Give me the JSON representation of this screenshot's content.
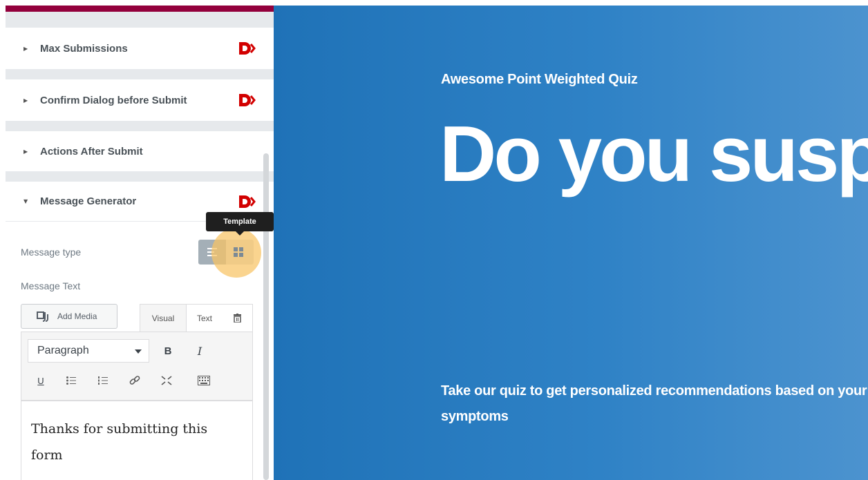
{
  "panel": {
    "sections": [
      {
        "label": "Max Submissions"
      },
      {
        "label": "Confirm Dialog before Submit"
      },
      {
        "label": "Actions After Submit"
      },
      {
        "label": "Message Generator"
      }
    ],
    "message_type_label": "Message type",
    "message_text_label": "Message Text",
    "tooltip": "Template",
    "add_media_label": "Add Media",
    "tab_visual": "Visual",
    "tab_text": "Text",
    "format_value": "Paragraph",
    "bold_label": "B",
    "italic_label": "I",
    "underline_label": "U",
    "editor_content": "Thanks for submitting this form"
  },
  "canvas": {
    "eyebrow": "Awesome Point Weighted Quiz",
    "headline": "Do you suspect a deficiency?",
    "subtext": "Take our quiz to get personalized recommendations based on your unique symptoms"
  },
  "colors": {
    "accent": "#93003c",
    "brand_logo": "#d20000",
    "canvas_bg": "#2a7dc2",
    "highlight": "#f8c464"
  }
}
